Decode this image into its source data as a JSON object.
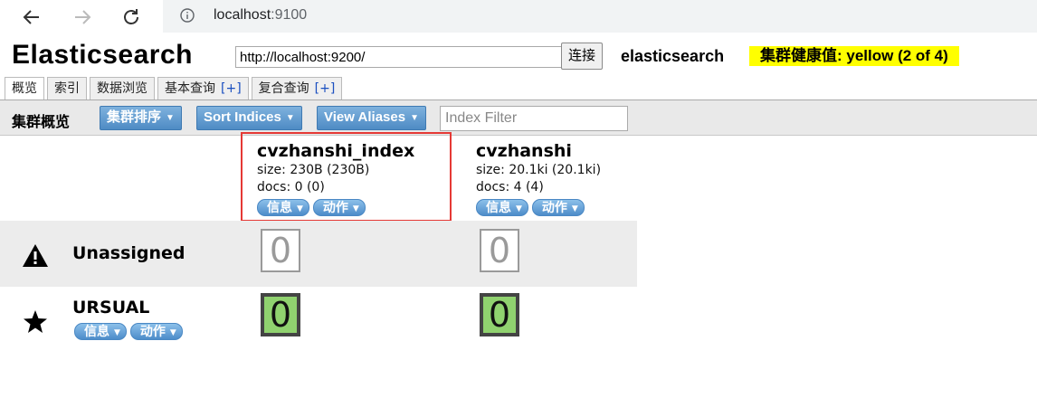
{
  "browser": {
    "url_host": "localhost",
    "url_port": ":9100"
  },
  "header": {
    "title": "Elasticsearch",
    "server_url": "http://localhost:9200/",
    "connect_label": "连接",
    "cluster_name": "elasticsearch",
    "health_text": "集群健康值: yellow (2 of 4)",
    "health_color": "#ffff00"
  },
  "tabs": [
    {
      "label": "概览",
      "plus": ""
    },
    {
      "label": "索引",
      "plus": ""
    },
    {
      "label": "数据浏览",
      "plus": ""
    },
    {
      "label": "基本查询",
      "plus": "[+]"
    },
    {
      "label": "复合查询",
      "plus": "[+]"
    }
  ],
  "toolbar": {
    "title": "集群概览",
    "sort_cluster_label": "集群排序",
    "sort_indices_label": "Sort Indices",
    "view_aliases_label": "View Aliases",
    "filter_placeholder": "Index Filter"
  },
  "indices": [
    {
      "name": "cvzhanshi_index",
      "size": "size: 230B (230B)",
      "docs": "docs: 0 (0)",
      "info_label": "信息",
      "action_label": "动作",
      "highlighted": true
    },
    {
      "name": "cvzhanshi",
      "size": "size: 20.1ki (20.1ki)",
      "docs": "docs: 4 (4)",
      "info_label": "信息",
      "action_label": "动作",
      "highlighted": false
    }
  ],
  "rows": {
    "unassigned": {
      "label": "Unassigned",
      "icon": "warning-icon",
      "shards": [
        "0",
        "0"
      ]
    },
    "node": {
      "label": "URSUAL",
      "icon": "star-icon",
      "info_label": "信息",
      "action_label": "动作",
      "shards": [
        "0",
        "0"
      ]
    }
  },
  "colors": {
    "button_blue": "#4e8bc4",
    "primary_shard": "#90d26f",
    "highlight_border": "#e53935"
  }
}
